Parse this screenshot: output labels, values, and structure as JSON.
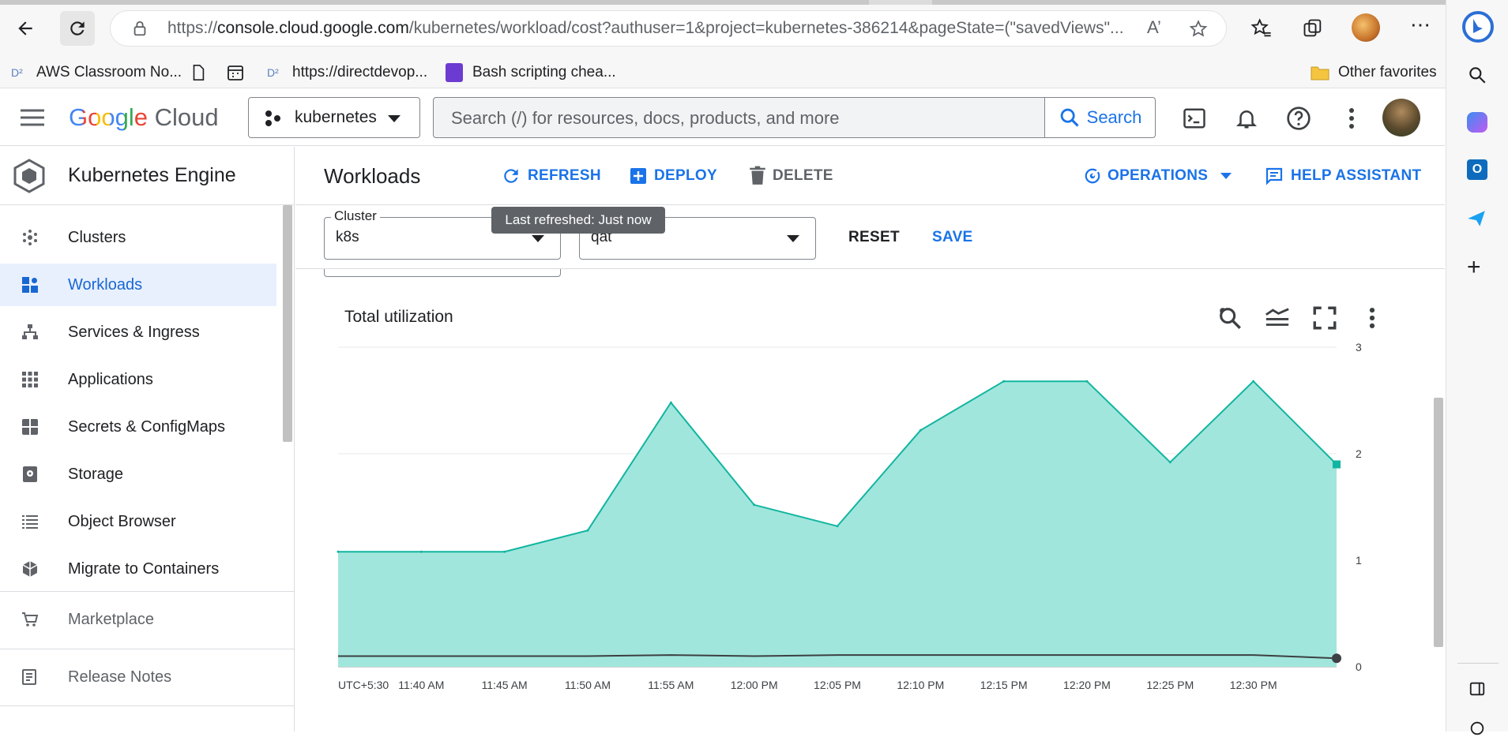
{
  "browser": {
    "url_prefix": "https://",
    "url_host": "console.cloud.google.com",
    "url_rest": "/kubernetes/workload/cost?authuser=1&project=kubernetes-386214&pageState=(\"savedViews\"..."
  },
  "bookmarks": [
    {
      "label": "AWS Classroom No..."
    },
    {
      "label": "https://directdevop..."
    },
    {
      "label": "Bash scripting chea..."
    }
  ],
  "other_favorites": "Other favorites",
  "header": {
    "logo_google": "Google",
    "logo_cloud": "Cloud",
    "project": "kubernetes",
    "search_placeholder": "Search (/) for resources, docs, products, and more",
    "search_label": "Search"
  },
  "sidebar": {
    "title": "Kubernetes Engine",
    "items": [
      {
        "label": "Clusters",
        "icon": "clusters-icon"
      },
      {
        "label": "Workloads",
        "icon": "workloads-icon",
        "active": true
      },
      {
        "label": "Services & Ingress",
        "icon": "services-icon"
      },
      {
        "label": "Applications",
        "icon": "applications-icon"
      },
      {
        "label": "Secrets & ConfigMaps",
        "icon": "secrets-icon"
      },
      {
        "label": "Storage",
        "icon": "storage-icon"
      },
      {
        "label": "Object Browser",
        "icon": "object-browser-icon"
      },
      {
        "label": "Migrate to Containers",
        "icon": "migrate-icon"
      }
    ],
    "marketplace": "Marketplace",
    "release_notes": "Release Notes"
  },
  "toolbar": {
    "title": "Workloads",
    "refresh": "REFRESH",
    "deploy": "DEPLOY",
    "delete": "DELETE",
    "operations": "OPERATIONS",
    "help_assistant": "HELP ASSISTANT"
  },
  "filters": {
    "cluster_label": "Cluster",
    "cluster_value": "k8s",
    "namespace_value": "qat",
    "reset": "RESET",
    "save": "SAVE",
    "tooltip": "Last refreshed: Just now"
  },
  "colors": {
    "accent": "#1a73e8",
    "area_fill": "#a1e6dc",
    "area_line": "#12b5a0",
    "secondary_line": "#3c4043"
  },
  "chart_data": {
    "type": "area",
    "title": "Total utilization",
    "x": [
      "UTC+5:30",
      "11:40 AM",
      "11:45 AM",
      "11:50 AM",
      "11:55 AM",
      "12:00 PM",
      "12:05 PM",
      "12:10 PM",
      "12:15 PM",
      "12:20 PM",
      "12:25 PM",
      "12:30 PM"
    ],
    "xlabels": [
      "UTC+5:30",
      "11:40 AM",
      "11:45 AM",
      "11:50 AM",
      "11:55 AM",
      "12:00 PM",
      "12:05 PM",
      "12:10 PM",
      "12:15 PM",
      "12:20 PM",
      "12:25 PM",
      "12:30 PM"
    ],
    "ylim": [
      0,
      3
    ],
    "yticks": [
      0,
      1,
      2,
      3
    ],
    "y_axis_position": "right",
    "grid": true,
    "series": [
      {
        "values": [
          1.08,
          1.08,
          1.08,
          1.28,
          2.48,
          1.52,
          1.32,
          2.22,
          2.68,
          2.68,
          1.92,
          2.68,
          1.9
        ]
      },
      {
        "values": [
          0.1,
          0.1,
          0.1,
          0.1,
          0.11,
          0.1,
          0.11,
          0.11,
          0.11,
          0.11,
          0.11,
          0.11,
          0.08
        ]
      }
    ]
  }
}
